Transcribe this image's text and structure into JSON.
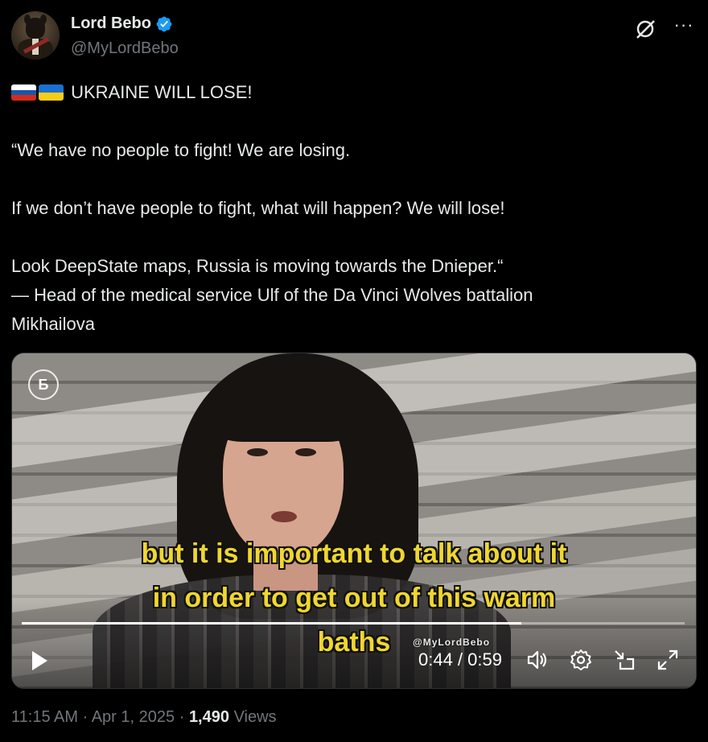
{
  "author": {
    "display_name": "Lord Bebo",
    "handle": "@MyLordBebo"
  },
  "header": {
    "more_label": "···"
  },
  "tweet": {
    "line1": "UKRAINE WILL LOSE!",
    "line2": "“We have no people to fight! We are losing.",
    "line3": "If we don’t have people to fight, what will happen?  We will lose!",
    "line4": "Look DeepState maps, Russia is moving towards the Dnieper.“",
    "line5": "— Head of the medical service Ulf of the Da Vinci Wolves battalion",
    "line6": "Mikhailova"
  },
  "video": {
    "channel_logo": "Б",
    "subtitle_line1": "but it is important to talk about it",
    "subtitle_line2": "in order to get out of this warm",
    "subtitle_line3": "baths",
    "watermark": "@MyLordBebo",
    "time_display": "0:44 / 0:59",
    "progress_fraction": 0.754
  },
  "meta": {
    "time": "11:15 AM",
    "sep1": "·",
    "date": "Apr 1, 2025",
    "sep2": "·",
    "views_count": "1,490",
    "views_label": "Views"
  },
  "colors": {
    "verified": "#1d9bf0",
    "subtitle": "#f0d630",
    "secondary_text": "#71767b"
  },
  "icons": [
    "verified-badge-icon",
    "grok-icon",
    "more-icon",
    "russia-flag-icon",
    "ukraine-flag-icon",
    "play-icon",
    "volume-icon",
    "settings-icon",
    "minimize-icon",
    "fullscreen-icon"
  ]
}
